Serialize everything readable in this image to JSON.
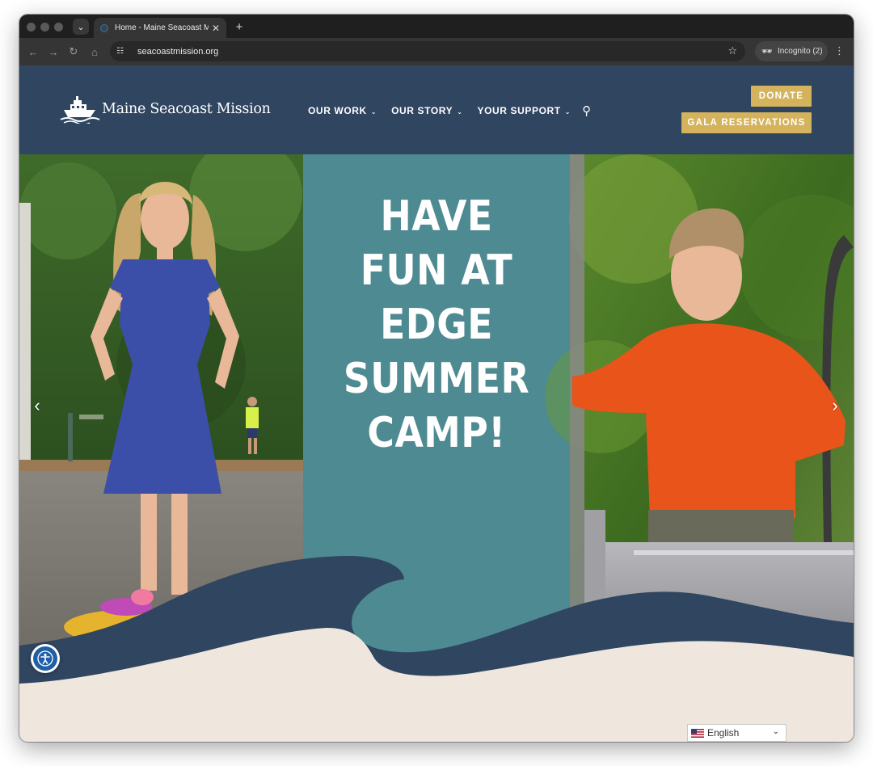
{
  "browser": {
    "tab_title": "Home - Maine Seacoast Missio",
    "url": "seacoastmission.org",
    "incognito_label": "Incognito (2)",
    "icons": [
      "back-icon",
      "forward-icon",
      "reload-icon",
      "home-icon",
      "site-info-icon",
      "bookmark-star-icon",
      "incognito-icon",
      "menu-icon",
      "tab-search-icon",
      "close-tab-icon",
      "new-tab-icon"
    ]
  },
  "header": {
    "logo_text": "Maine Seacoast Mission",
    "nav": [
      {
        "label": "OUR WORK"
      },
      {
        "label": "OUR STORY"
      },
      {
        "label": "YOUR SUPPORT"
      }
    ],
    "donate_label": "DONATE",
    "gala_label": "GALA RESERVATIONS",
    "colors": {
      "header_bg": "#2f4560",
      "button_gold": "#d5b25c"
    }
  },
  "hero": {
    "headline_lines": [
      "HAVE",
      "FUN AT",
      "EDGE",
      "SUMMER",
      "CAMP!"
    ],
    "prev_arrow": "‹",
    "next_arrow": "›",
    "left_photo": "girl in blue dress standing on playground",
    "right_photo": "boy in orange sweater on playground slide",
    "colors": {
      "panel_teal": "#4e8a91",
      "wave_navy": "#2f4560",
      "sand": "#efe7de"
    }
  },
  "language": {
    "selected": "English"
  }
}
